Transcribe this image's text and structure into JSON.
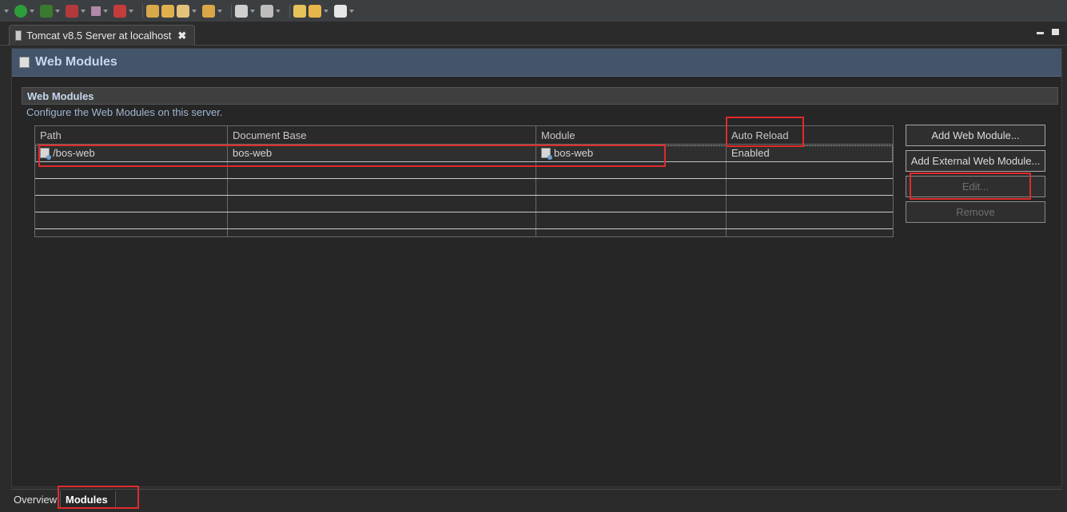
{
  "editor_tab": {
    "title": "Tomcat v8.5 Server at localhost",
    "close_glyph": "✖"
  },
  "form": {
    "title": "Web Modules"
  },
  "section": {
    "title": "Web Modules",
    "description": "Configure the Web Modules on this server."
  },
  "table": {
    "columns": [
      "Path",
      "Document Base",
      "Module",
      "Auto Reload"
    ],
    "rows": [
      {
        "path": "/bos-web",
        "document_base": "bos-web",
        "module": "bos-web",
        "auto_reload": "Enabled"
      }
    ]
  },
  "buttons": {
    "add_web_module": "Add Web Module...",
    "add_external_web_module": "Add External Web Module...",
    "edit": "Edit...",
    "remove": "Remove"
  },
  "bottom_tabs": {
    "overview": "Overview",
    "modules": "Modules"
  },
  "colors": {
    "header_bg": "#44546a",
    "title_text": "#c7d8ee",
    "annotation_red": "#e02b2b"
  },
  "toolbar_icons": [
    "debug-icon",
    "run-icon",
    "profile-icon",
    "coverage-icon",
    "stop-icon",
    "disconnect-icon",
    "open-folder-icon",
    "open-file-icon",
    "brush-icon",
    "folder-icon",
    "source-icon",
    "server-icon",
    "back-icon",
    "forward-icon",
    "next-icon"
  ]
}
